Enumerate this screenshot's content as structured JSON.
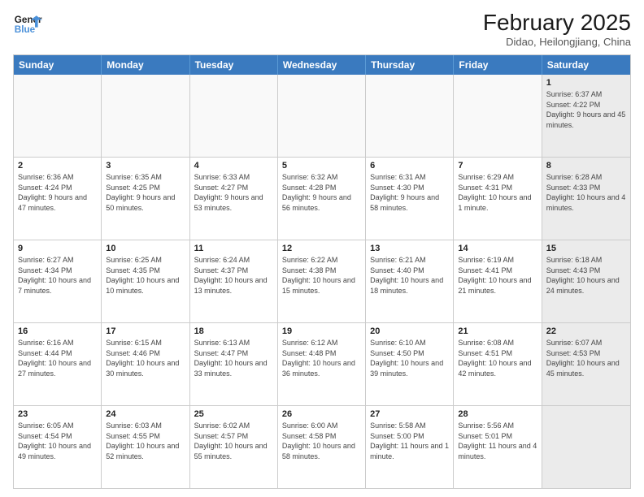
{
  "logo": {
    "line1": "General",
    "line2": "Blue"
  },
  "title": "February 2025",
  "subtitle": "Didao, Heilongjiang, China",
  "header_days": [
    "Sunday",
    "Monday",
    "Tuesday",
    "Wednesday",
    "Thursday",
    "Friday",
    "Saturday"
  ],
  "rows": [
    [
      {
        "day": "",
        "info": "",
        "shaded": false,
        "empty": true
      },
      {
        "day": "",
        "info": "",
        "shaded": false,
        "empty": true
      },
      {
        "day": "",
        "info": "",
        "shaded": false,
        "empty": true
      },
      {
        "day": "",
        "info": "",
        "shaded": false,
        "empty": true
      },
      {
        "day": "",
        "info": "",
        "shaded": false,
        "empty": true
      },
      {
        "day": "",
        "info": "",
        "shaded": false,
        "empty": true
      },
      {
        "day": "1",
        "info": "Sunrise: 6:37 AM\nSunset: 4:22 PM\nDaylight: 9 hours and 45 minutes.",
        "shaded": true,
        "empty": false
      }
    ],
    [
      {
        "day": "2",
        "info": "Sunrise: 6:36 AM\nSunset: 4:24 PM\nDaylight: 9 hours and 47 minutes.",
        "shaded": false,
        "empty": false
      },
      {
        "day": "3",
        "info": "Sunrise: 6:35 AM\nSunset: 4:25 PM\nDaylight: 9 hours and 50 minutes.",
        "shaded": false,
        "empty": false
      },
      {
        "day": "4",
        "info": "Sunrise: 6:33 AM\nSunset: 4:27 PM\nDaylight: 9 hours and 53 minutes.",
        "shaded": false,
        "empty": false
      },
      {
        "day": "5",
        "info": "Sunrise: 6:32 AM\nSunset: 4:28 PM\nDaylight: 9 hours and 56 minutes.",
        "shaded": false,
        "empty": false
      },
      {
        "day": "6",
        "info": "Sunrise: 6:31 AM\nSunset: 4:30 PM\nDaylight: 9 hours and 58 minutes.",
        "shaded": false,
        "empty": false
      },
      {
        "day": "7",
        "info": "Sunrise: 6:29 AM\nSunset: 4:31 PM\nDaylight: 10 hours and 1 minute.",
        "shaded": false,
        "empty": false
      },
      {
        "day": "8",
        "info": "Sunrise: 6:28 AM\nSunset: 4:33 PM\nDaylight: 10 hours and 4 minutes.",
        "shaded": true,
        "empty": false
      }
    ],
    [
      {
        "day": "9",
        "info": "Sunrise: 6:27 AM\nSunset: 4:34 PM\nDaylight: 10 hours and 7 minutes.",
        "shaded": false,
        "empty": false
      },
      {
        "day": "10",
        "info": "Sunrise: 6:25 AM\nSunset: 4:35 PM\nDaylight: 10 hours and 10 minutes.",
        "shaded": false,
        "empty": false
      },
      {
        "day": "11",
        "info": "Sunrise: 6:24 AM\nSunset: 4:37 PM\nDaylight: 10 hours and 13 minutes.",
        "shaded": false,
        "empty": false
      },
      {
        "day": "12",
        "info": "Sunrise: 6:22 AM\nSunset: 4:38 PM\nDaylight: 10 hours and 15 minutes.",
        "shaded": false,
        "empty": false
      },
      {
        "day": "13",
        "info": "Sunrise: 6:21 AM\nSunset: 4:40 PM\nDaylight: 10 hours and 18 minutes.",
        "shaded": false,
        "empty": false
      },
      {
        "day": "14",
        "info": "Sunrise: 6:19 AM\nSunset: 4:41 PM\nDaylight: 10 hours and 21 minutes.",
        "shaded": false,
        "empty": false
      },
      {
        "day": "15",
        "info": "Sunrise: 6:18 AM\nSunset: 4:43 PM\nDaylight: 10 hours and 24 minutes.",
        "shaded": true,
        "empty": false
      }
    ],
    [
      {
        "day": "16",
        "info": "Sunrise: 6:16 AM\nSunset: 4:44 PM\nDaylight: 10 hours and 27 minutes.",
        "shaded": false,
        "empty": false
      },
      {
        "day": "17",
        "info": "Sunrise: 6:15 AM\nSunset: 4:46 PM\nDaylight: 10 hours and 30 minutes.",
        "shaded": false,
        "empty": false
      },
      {
        "day": "18",
        "info": "Sunrise: 6:13 AM\nSunset: 4:47 PM\nDaylight: 10 hours and 33 minutes.",
        "shaded": false,
        "empty": false
      },
      {
        "day": "19",
        "info": "Sunrise: 6:12 AM\nSunset: 4:48 PM\nDaylight: 10 hours and 36 minutes.",
        "shaded": false,
        "empty": false
      },
      {
        "day": "20",
        "info": "Sunrise: 6:10 AM\nSunset: 4:50 PM\nDaylight: 10 hours and 39 minutes.",
        "shaded": false,
        "empty": false
      },
      {
        "day": "21",
        "info": "Sunrise: 6:08 AM\nSunset: 4:51 PM\nDaylight: 10 hours and 42 minutes.",
        "shaded": false,
        "empty": false
      },
      {
        "day": "22",
        "info": "Sunrise: 6:07 AM\nSunset: 4:53 PM\nDaylight: 10 hours and 45 minutes.",
        "shaded": true,
        "empty": false
      }
    ],
    [
      {
        "day": "23",
        "info": "Sunrise: 6:05 AM\nSunset: 4:54 PM\nDaylight: 10 hours and 49 minutes.",
        "shaded": false,
        "empty": false
      },
      {
        "day": "24",
        "info": "Sunrise: 6:03 AM\nSunset: 4:55 PM\nDaylight: 10 hours and 52 minutes.",
        "shaded": false,
        "empty": false
      },
      {
        "day": "25",
        "info": "Sunrise: 6:02 AM\nSunset: 4:57 PM\nDaylight: 10 hours and 55 minutes.",
        "shaded": false,
        "empty": false
      },
      {
        "day": "26",
        "info": "Sunrise: 6:00 AM\nSunset: 4:58 PM\nDaylight: 10 hours and 58 minutes.",
        "shaded": false,
        "empty": false
      },
      {
        "day": "27",
        "info": "Sunrise: 5:58 AM\nSunset: 5:00 PM\nDaylight: 11 hours and 1 minute.",
        "shaded": false,
        "empty": false
      },
      {
        "day": "28",
        "info": "Sunrise: 5:56 AM\nSunset: 5:01 PM\nDaylight: 11 hours and 4 minutes.",
        "shaded": false,
        "empty": false
      },
      {
        "day": "",
        "info": "",
        "shaded": true,
        "empty": true
      }
    ]
  ]
}
